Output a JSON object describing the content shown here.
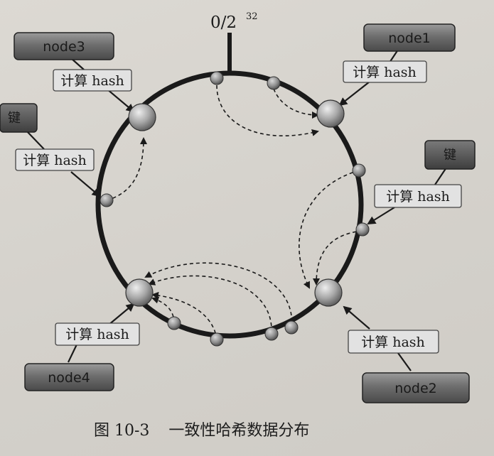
{
  "ring_top_label": {
    "base": "0/2",
    "exponent": "32"
  },
  "hash_label": "计算 hash",
  "nodes": [
    {
      "id": "node1",
      "label": "node1"
    },
    {
      "id": "node2",
      "label": "node2"
    },
    {
      "id": "node3",
      "label": "node3"
    },
    {
      "id": "node4",
      "label": "node4"
    }
  ],
  "keys": [
    {
      "id": "key-left",
      "label": "键"
    },
    {
      "id": "key-right",
      "label": "键"
    }
  ],
  "caption": {
    "number": "图 10-3",
    "text": "一致性哈希数据分布"
  },
  "colors": {
    "ring": "#1a1a1a",
    "node_box": "#6a6a6a",
    "hash_box": "#e2e2e2",
    "sphere": "#a9a9a9"
  }
}
